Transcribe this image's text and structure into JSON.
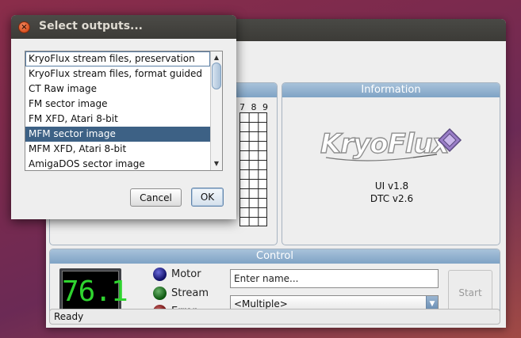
{
  "main_window": {
    "information_panel": {
      "header": "Information",
      "logo_text": "KryoFlux",
      "ui_version": "UI v1.8",
      "dtc_version": "DTC v2.6"
    },
    "grid": {
      "column_numbers": "7 8 9"
    },
    "control_panel": {
      "header": "Control",
      "lcd_value": "76.1",
      "lcd_color": "#2fd42f",
      "indicators": [
        {
          "label": "Motor",
          "color": "#1a1a8a"
        },
        {
          "label": "Stream",
          "color": "#0f6a14"
        },
        {
          "label": "Error",
          "color": "#7a1010"
        }
      ],
      "name_placeholder": "Enter name...",
      "format_selected": "<Multiple>",
      "start_label": "Start"
    },
    "status": "Ready"
  },
  "dialog": {
    "title": "Select outputs...",
    "items": [
      {
        "label": "KryoFlux stream files, preservation"
      },
      {
        "label": "KryoFlux stream files, format guided"
      },
      {
        "label": "CT Raw image"
      },
      {
        "label": "FM sector image"
      },
      {
        "label": "FM XFD, Atari 8-bit"
      },
      {
        "label": "MFM sector image"
      },
      {
        "label": "MFM XFD, Atari 8-bit"
      },
      {
        "label": "AmigaDOS sector image"
      }
    ],
    "selected_index": 5,
    "cancel_label": "Cancel",
    "ok_label": "OK"
  },
  "colors": {
    "selection": "#3d6185",
    "panel_header": "#8fb0cf",
    "desktop": "#7a2a4e"
  }
}
